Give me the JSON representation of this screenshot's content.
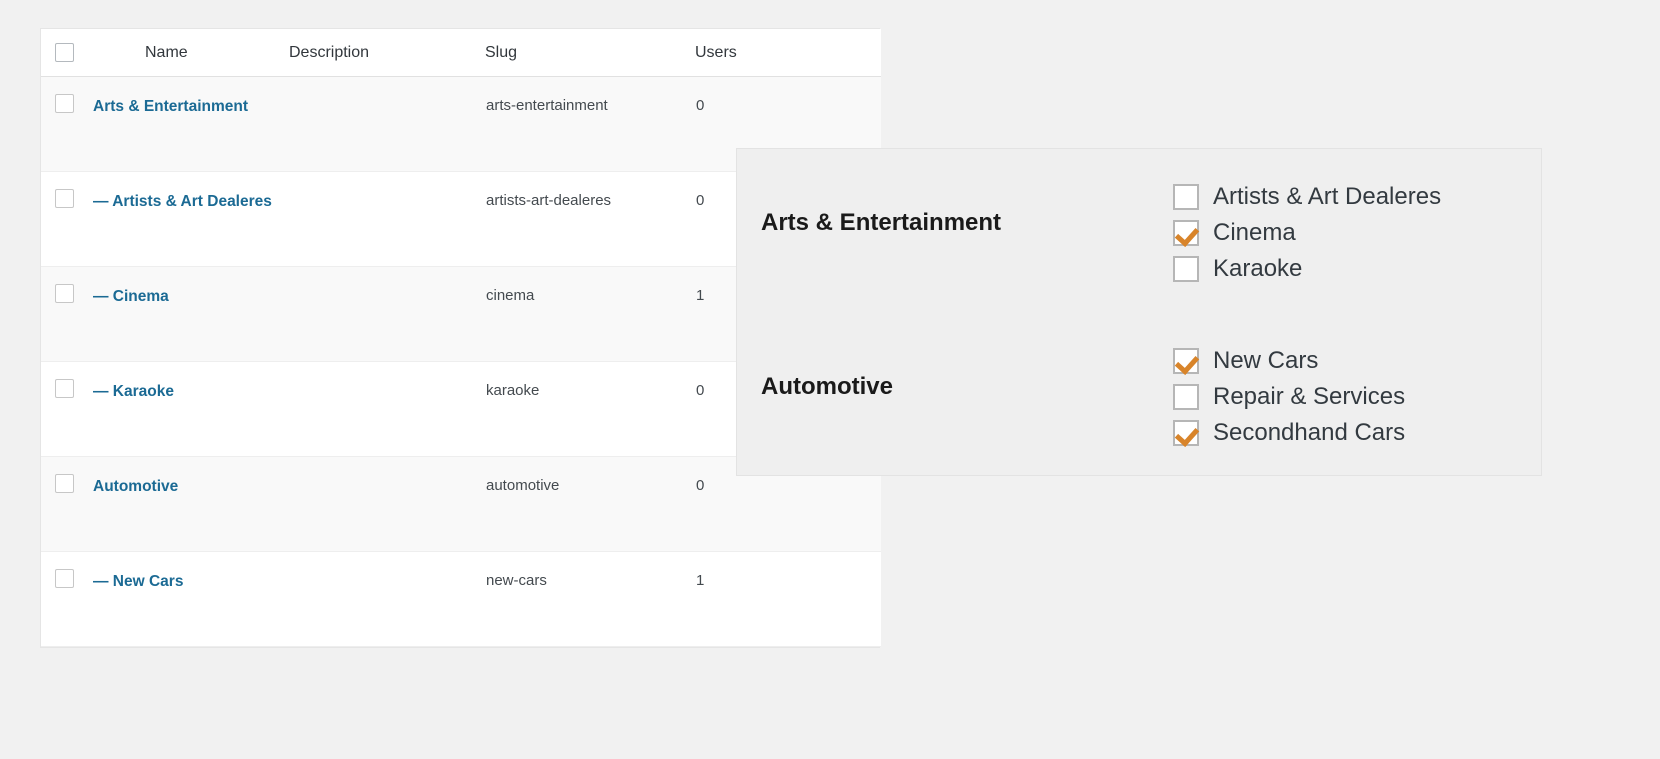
{
  "table": {
    "columns": [
      {
        "key": "cb",
        "label": ""
      },
      {
        "key": "name",
        "label": "Name"
      },
      {
        "key": "desc",
        "label": "Description"
      },
      {
        "key": "slug",
        "label": "Slug"
      },
      {
        "key": "users",
        "label": "Users"
      }
    ],
    "rows": [
      {
        "name": "Arts & Entertainment",
        "description": "",
        "slug": "arts-entertainment",
        "users": "0",
        "checked": false
      },
      {
        "name": "— Artists & Art Dealeres",
        "description": "",
        "slug": "artists-art-dealeres",
        "users": "0",
        "checked": false
      },
      {
        "name": "— Cinema",
        "description": "",
        "slug": "cinema",
        "users": "1",
        "checked": false
      },
      {
        "name": "— Karaoke",
        "description": "",
        "slug": "karaoke",
        "users": "0",
        "checked": false
      },
      {
        "name": "Automotive",
        "description": "",
        "slug": "automotive",
        "users": "0",
        "checked": false
      },
      {
        "name": "— New Cars",
        "description": "",
        "slug": "new-cars",
        "users": "1",
        "checked": false
      }
    ]
  },
  "overlay": {
    "groups": [
      {
        "title": "Arts & Entertainment",
        "options": [
          {
            "label": "Artists & Art Dealeres",
            "checked": false
          },
          {
            "label": "Cinema",
            "checked": true
          },
          {
            "label": "Karaoke",
            "checked": false
          }
        ]
      },
      {
        "title": "Automotive",
        "options": [
          {
            "label": "New Cars",
            "checked": true
          },
          {
            "label": "Repair & Services",
            "checked": false
          },
          {
            "label": "Secondhand Cars",
            "checked": true
          }
        ]
      }
    ]
  },
  "colors": {
    "link": "#1b6a94",
    "check_accent": "#d8842a",
    "page_background": "#f1f1f1",
    "panel_background": "#efefef",
    "row_alt": "#f9f9f9"
  }
}
